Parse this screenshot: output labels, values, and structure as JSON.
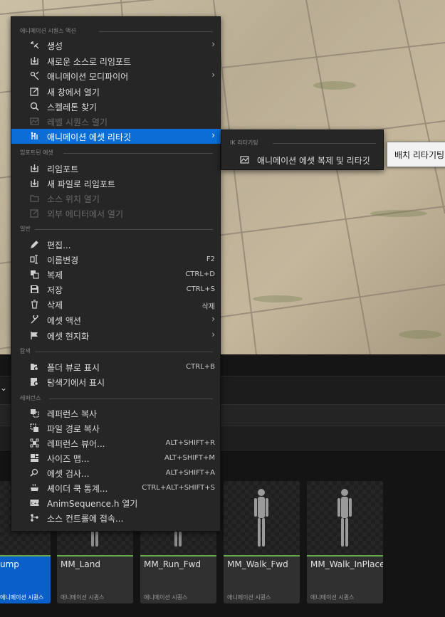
{
  "menu": {
    "sections": {
      "anim": "애니메이션 시퀀스 액션",
      "imported": "임포트된 에셋",
      "general": "일반",
      "explore": "탐색",
      "reference": "레퍼런스"
    },
    "items": {
      "create": "생성",
      "reimport_new_source": "새로운 소스로 리임포트",
      "anim_modifier": "애니메이션 모디파이어",
      "open_new_window": "새 창에서 열기",
      "find_skeleton": "스켈레톤 찾기",
      "open_level_sequence": "레벨 시퀀스 열기",
      "retarget_anim_assets": "애니메이션 에셋 리타깃",
      "reimport": "리임포트",
      "reimport_new_file": "새 파일로 리임포트",
      "open_source_location": "소스 위치 열기",
      "open_external_editor": "외부 에디터에서 열기",
      "edit": "편집...",
      "rename": "이름변경",
      "rename_sc": "F2",
      "duplicate": "복제",
      "duplicate_sc": "CTRL+D",
      "save": "저장",
      "save_sc": "CTRL+S",
      "delete": "삭제",
      "delete_sc": "삭제",
      "asset_actions": "에셋 액션",
      "asset_localization": "에셋 현지화",
      "show_folder_view": "폴더 뷰로 표시",
      "show_folder_view_sc": "CTRL+B",
      "show_in_explorer": "탐색기에서 표시",
      "copy_reference": "레퍼런스 복사",
      "copy_file_path": "파일 경로 복사",
      "reference_viewer": "레퍼런스 뷰어...",
      "reference_viewer_sc": "ALT+SHIFT+R",
      "size_map": "사이즈 맵...",
      "size_map_sc": "ALT+SHIFT+M",
      "audit_asset": "에셋 검사...",
      "audit_asset_sc": "ALT+SHIFT+A",
      "shader_cook_stats": "셰이더 쿡 통계...",
      "shader_cook_stats_sc": "CTRL+ALT+SHIFT+S",
      "open_header": "AnimSequence.h 열기",
      "source_control": "소스 컨트롤에 접속..."
    }
  },
  "submenu": {
    "section": "IK 리타기팅",
    "item": "애니메이션 에셋 복제 및 리타깃"
  },
  "tooltip": "배치 리타기팅",
  "tiles": [
    {
      "name": "ump",
      "type": "애니메이션 시퀀스"
    },
    {
      "name": "MM_Land",
      "type": "애니메이션 시퀀스"
    },
    {
      "name": "MM_Run_Fwd",
      "type": "애니메이션 시퀀스"
    },
    {
      "name": "MM_Walk_Fwd",
      "type": "애니메이션 시퀀스"
    },
    {
      "name": "MM_Walk_InPlace",
      "type": "애니메이션 시퀀스"
    }
  ],
  "colors": {
    "highlight": "#0b6ed6",
    "selected_tile": "#0a60c8",
    "anim_strip": "#6aa84f"
  }
}
